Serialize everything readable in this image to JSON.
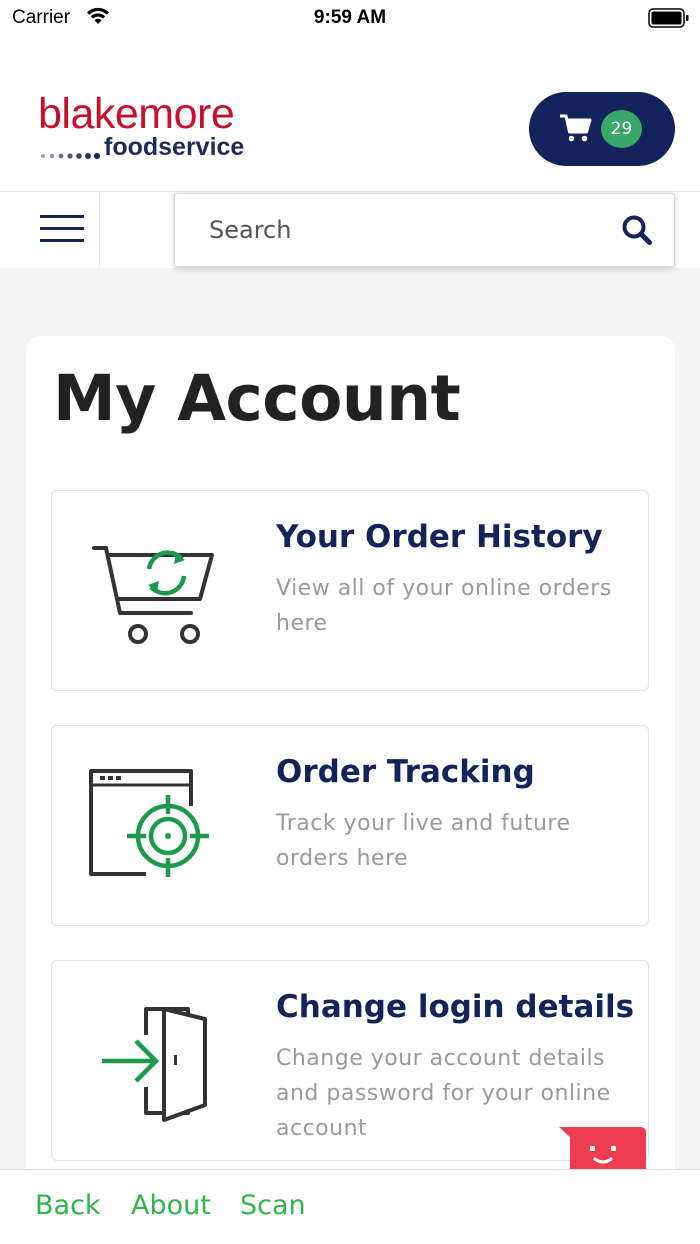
{
  "status_bar": {
    "carrier": "Carrier",
    "time": "9:59 AM"
  },
  "header": {
    "logo_top": "blakemore",
    "logo_bottom": "foodservice",
    "cart_count": "29"
  },
  "search": {
    "placeholder": "Search"
  },
  "page": {
    "title": "My Account",
    "items": [
      {
        "title": "Your Order History",
        "description": "View all of your online orders here",
        "icon": "cart-refresh-icon"
      },
      {
        "title": "Order Tracking",
        "description": "Track your live and future orders here",
        "icon": "target-window-icon"
      },
      {
        "title": "Change login details",
        "description": "Change your account details and password for your online account",
        "icon": "login-door-icon"
      }
    ]
  },
  "bottom_nav": {
    "back": "Back",
    "about": "About",
    "scan": "Scan"
  },
  "colors": {
    "brand_navy": "#13235b",
    "brand_red": "#c8102e",
    "accent_green": "#2fb54a",
    "badge_green": "#38a869",
    "chat_red": "#ee3d52"
  }
}
